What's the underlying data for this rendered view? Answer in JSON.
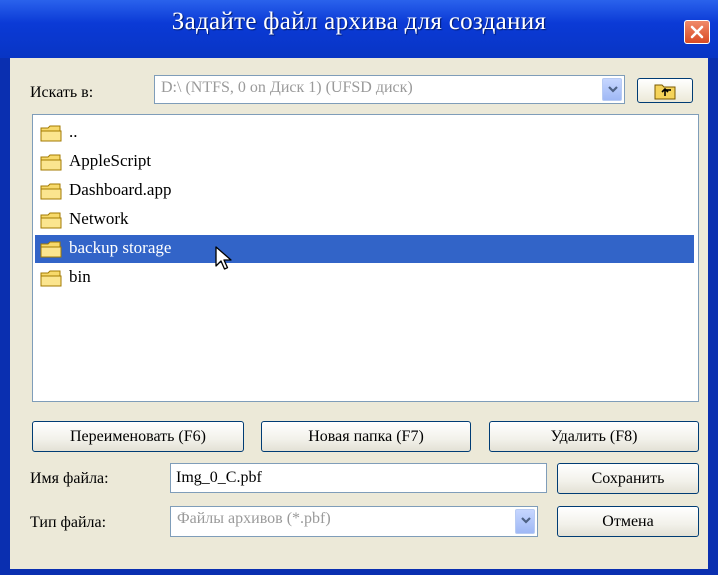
{
  "window": {
    "title": "Задайте файл архива для создания"
  },
  "lookin": {
    "label": "Искать в:",
    "value": "D:\\  (NTFS, 0 on Диск 1) (UFSD диск)"
  },
  "icons": {
    "close": "close-icon",
    "up": "folder-up-icon",
    "folder": "folder-icon",
    "dropdown": "chevron-down-icon",
    "cursor": "mouse-pointer-icon"
  },
  "files": [
    {
      "name": "..",
      "selected": false
    },
    {
      "name": "AppleScript",
      "selected": false
    },
    {
      "name": "Dashboard.app",
      "selected": false
    },
    {
      "name": "Network",
      "selected": false
    },
    {
      "name": "backup storage",
      "selected": true
    },
    {
      "name": "bin",
      "selected": false
    }
  ],
  "buttons": {
    "rename": "Переименовать (F6)",
    "new_folder": "Новая папка (F7)",
    "delete": "Удалить (F8)",
    "save": "Сохранить",
    "cancel": "Отмена"
  },
  "filename": {
    "label": "Имя файла:",
    "value": "Img_0_C.pbf"
  },
  "filetype": {
    "label": "Тип файла:",
    "value": "Файлы архивов (*.pbf)"
  },
  "colors": {
    "titlebar": "#0b3ad6",
    "selection": "#3264c8",
    "dialog_bg": "#ece9d8"
  }
}
